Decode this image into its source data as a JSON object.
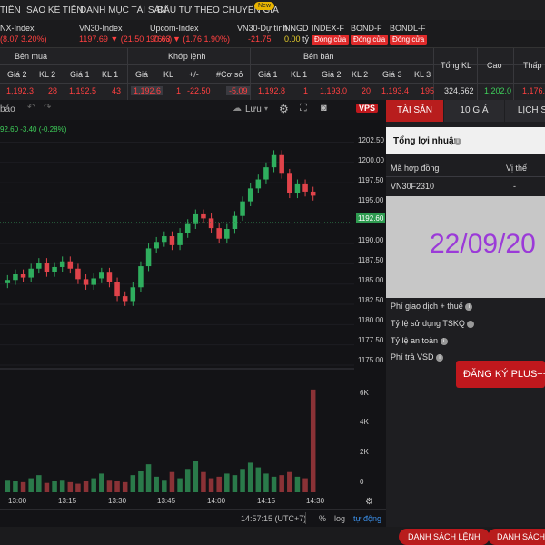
{
  "topnav": {
    "items": [
      "TIỀN",
      "SAO KÊ TIỀN",
      "DANH MỤC TÀI SẢN",
      "ĐẦU TƯ THEO CHUYÊN GIA"
    ],
    "badge": "New"
  },
  "indices": [
    {
      "name": "NX-Index",
      "value": "(8.07 3.20%)",
      "color": "red"
    },
    {
      "name": "VN30-Index",
      "value": "1197.69 ▼ (21.50 1.76%)",
      "color": "red"
    },
    {
      "name": "Upcom-Index",
      "value": "90.63 ▼ (1.76 1.90%)",
      "color": "red"
    },
    {
      "name": "VN30-Dự tính",
      "value": "-21.75",
      "color": "red"
    },
    {
      "name": "NNGD",
      "value": "0.00",
      "unit": "tỷ",
      "color": "yellow"
    },
    {
      "name": "INDEX-F",
      "status": "Đóng cửa"
    },
    {
      "name": "BOND-F",
      "status": "Đóng cửa"
    },
    {
      "name": "BONDL-F",
      "status": "Đóng cửa"
    }
  ],
  "board": {
    "groups": {
      "buy": "Bên mua",
      "match": "Khớp lệnh",
      "sell": "Bên bán"
    },
    "headers": [
      "Giá 2",
      "KL 2",
      "Giá 1",
      "KL 1",
      "Giá",
      "KL",
      "+/-",
      "#Cơ sở",
      "Giá 1",
      "KL 1",
      "Giá 2",
      "KL 2",
      "Giá 3",
      "KL 3",
      "Tổng KL",
      "Cao",
      "Thấp"
    ],
    "values": [
      "1,192.3",
      "28",
      "1,192.5",
      "43",
      "1,192.6",
      "1",
      "-22.50",
      "-5.09",
      "1,192.8",
      "1",
      "1,193.0",
      "20",
      "1,193.4",
      "195",
      "324,562",
      "1,202.0",
      "1,176."
    ]
  },
  "chart": {
    "toolbar_left": "báo",
    "toolbar_save": "Lưu",
    "legend": "92.60 -3.40 (-0.28%)",
    "last_price": "1192.60",
    "price_ticks": [
      "1202.50",
      "1200.00",
      "1197.50",
      "1195.00",
      "1192.60",
      "1190.00",
      "1187.50",
      "1185.00",
      "1182.50",
      "1180.00",
      "1177.50",
      "1175.00"
    ],
    "vol_ticks": [
      "6K",
      "4K",
      "2K",
      "0"
    ],
    "time_ticks": [
      "13:00",
      "13:15",
      "13:30",
      "13:45",
      "14:00",
      "14:15",
      "14:30"
    ],
    "clock": "14:57:15 (UTC+7)",
    "scale_opts": [
      "%",
      "log",
      "tự động"
    ],
    "logo": "VPS"
  },
  "chart_data": {
    "type": "candlestick",
    "x": [
      "13:00",
      "13:15",
      "13:30",
      "13:45",
      "14:00",
      "14:15",
      "14:30"
    ],
    "ylim": [
      1175,
      1203
    ],
    "last": 1192.6,
    "close_series": [
      1185.5,
      1186.2,
      1185.8,
      1186.9,
      1187.6,
      1186.5,
      1187.1,
      1187.8,
      1186.9,
      1185.6,
      1184.9,
      1185.7,
      1186.4,
      1185.2,
      1183.5,
      1182.9,
      1184.6,
      1187.2,
      1189.4,
      1190.2,
      1190.9,
      1189.8,
      1191.3,
      1192.4,
      1193.6,
      1193.1,
      1191.9,
      1190.6,
      1191.8,
      1193.4,
      1195.2,
      1196.8,
      1197.9,
      1199.4,
      1200.9,
      1198.6,
      1196.2,
      1197.3,
      1196.4,
      1195.9
    ],
    "volume_series": [
      800,
      700,
      650,
      900,
      1100,
      600,
      700,
      800,
      650,
      550,
      700,
      900,
      1200,
      800,
      700,
      650,
      1100,
      1400,
      1800,
      1000,
      800,
      1300,
      900,
      1500,
      2000,
      1300,
      900,
      1000,
      1200,
      1100,
      1500,
      1900,
      1600,
      1200,
      1000,
      1100,
      1300,
      1000,
      900,
      6600
    ]
  },
  "rpanel": {
    "tabs": [
      "TÀI SẢN",
      "10 GIÁ",
      "LỊCH S"
    ],
    "profit_label": "Tổng lợi nhuận",
    "col_contract": "Mã hợp đồng",
    "col_position": "Vị thế",
    "contract": "VN30F2310",
    "position": "-",
    "date": "22/09/20",
    "metrics": [
      "Phí giao dịch + thuế",
      "Tỷ lệ sử dụng TSKQ",
      "Tỷ lệ an toàn",
      "Phí trả VSD"
    ],
    "plus_button": "ĐĂNG KÝ PLUS++"
  },
  "footer": {
    "buttons": [
      "DANH SÁCH LỆNH",
      "DANH SÁCH"
    ]
  }
}
